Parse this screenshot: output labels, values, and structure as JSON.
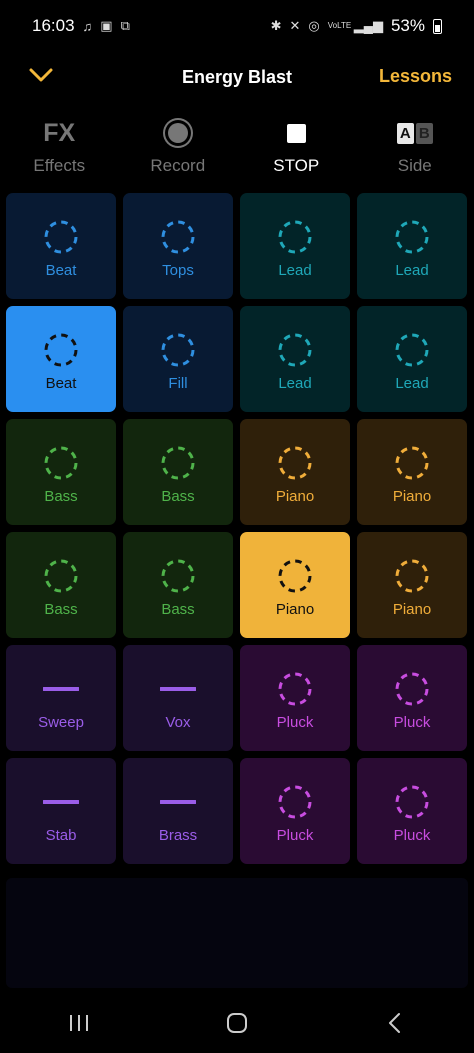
{
  "status_bar": {
    "time": "16:03",
    "battery": "53%",
    "left_icons": [
      "music-note-icon",
      "image-icon",
      "screen-share-icon"
    ],
    "right_icons": [
      "bluetooth-icon",
      "mute-icon",
      "hotspot-icon",
      "volte-icon",
      "signal-icon"
    ],
    "volte_label": "VoLTE"
  },
  "header": {
    "title": "Energy Blast",
    "lessons_label": "Lessons"
  },
  "toolbar": [
    {
      "icon": "fx-icon",
      "icon_text": "FX",
      "label": "Effects",
      "active": false
    },
    {
      "icon": "record-icon",
      "label": "Record",
      "active": false
    },
    {
      "icon": "stop-icon",
      "label": "STOP",
      "active": true
    },
    {
      "icon": "ab-side-icon",
      "icon_text_a": "A",
      "icon_text_b": "B",
      "label": "Side",
      "active": false
    }
  ],
  "colors": {
    "blue": "#2f8fe0",
    "blue_bg": "#081a33",
    "blue_active": "#2a8ff0",
    "teal": "#1fa8b8",
    "teal_bg": "#022428",
    "green": "#4fb34a",
    "green_bg": "#12260d",
    "orange": "#f0ad3a",
    "orange_bg": "#2f200a",
    "orange_active": "#f0b33a",
    "purple": "#9a5de8",
    "purple_bg": "#1a0f2c",
    "magenta": "#c84de0",
    "magenta_bg": "#2a0b33",
    "accent": "#f3b73a"
  },
  "pads": [
    {
      "label": "Beat",
      "color": "blue",
      "icon": "dashed-circle-icon",
      "active": false
    },
    {
      "label": "Tops",
      "color": "blue",
      "icon": "dashed-circle-icon",
      "active": false
    },
    {
      "label": "Lead",
      "color": "teal",
      "icon": "dashed-circle-icon",
      "active": false
    },
    {
      "label": "Lead",
      "color": "teal",
      "icon": "dashed-circle-icon",
      "active": false
    },
    {
      "label": "Beat",
      "color": "blue",
      "icon": "dashed-circle-icon",
      "active": true
    },
    {
      "label": "Fill",
      "color": "blue",
      "icon": "dashed-circle-icon",
      "active": false
    },
    {
      "label": "Lead",
      "color": "teal",
      "icon": "dashed-circle-icon",
      "active": false
    },
    {
      "label": "Lead",
      "color": "teal",
      "icon": "dashed-circle-icon",
      "active": false
    },
    {
      "label": "Bass",
      "color": "green",
      "icon": "dashed-circle-icon",
      "active": false
    },
    {
      "label": "Bass",
      "color": "green",
      "icon": "dashed-circle-icon",
      "active": false
    },
    {
      "label": "Piano",
      "color": "orange",
      "icon": "dashed-circle-icon",
      "active": false
    },
    {
      "label": "Piano",
      "color": "orange",
      "icon": "dashed-circle-icon",
      "active": false
    },
    {
      "label": "Bass",
      "color": "green",
      "icon": "dashed-circle-icon",
      "active": false
    },
    {
      "label": "Bass",
      "color": "green",
      "icon": "dashed-circle-icon",
      "active": false
    },
    {
      "label": "Piano",
      "color": "orange",
      "icon": "dashed-circle-icon",
      "active": true
    },
    {
      "label": "Piano",
      "color": "orange",
      "icon": "dashed-circle-icon",
      "active": false
    },
    {
      "label": "Sweep",
      "color": "purple",
      "icon": "dash-line-icon",
      "active": false
    },
    {
      "label": "Vox",
      "color": "purple",
      "icon": "dash-line-icon",
      "active": false
    },
    {
      "label": "Pluck",
      "color": "magenta",
      "icon": "dashed-circle-icon",
      "active": false
    },
    {
      "label": "Pluck",
      "color": "magenta",
      "icon": "dashed-circle-icon",
      "active": false
    },
    {
      "label": "Stab",
      "color": "purple",
      "icon": "dash-line-icon",
      "active": false
    },
    {
      "label": "Brass",
      "color": "purple",
      "icon": "dash-line-icon",
      "active": false
    },
    {
      "label": "Pluck",
      "color": "magenta",
      "icon": "dashed-circle-icon",
      "active": false
    },
    {
      "label": "Pluck",
      "color": "magenta",
      "icon": "dashed-circle-icon",
      "active": false
    }
  ],
  "nav_bar": [
    {
      "icon": "recent-apps-icon"
    },
    {
      "icon": "home-icon"
    },
    {
      "icon": "back-icon"
    }
  ]
}
